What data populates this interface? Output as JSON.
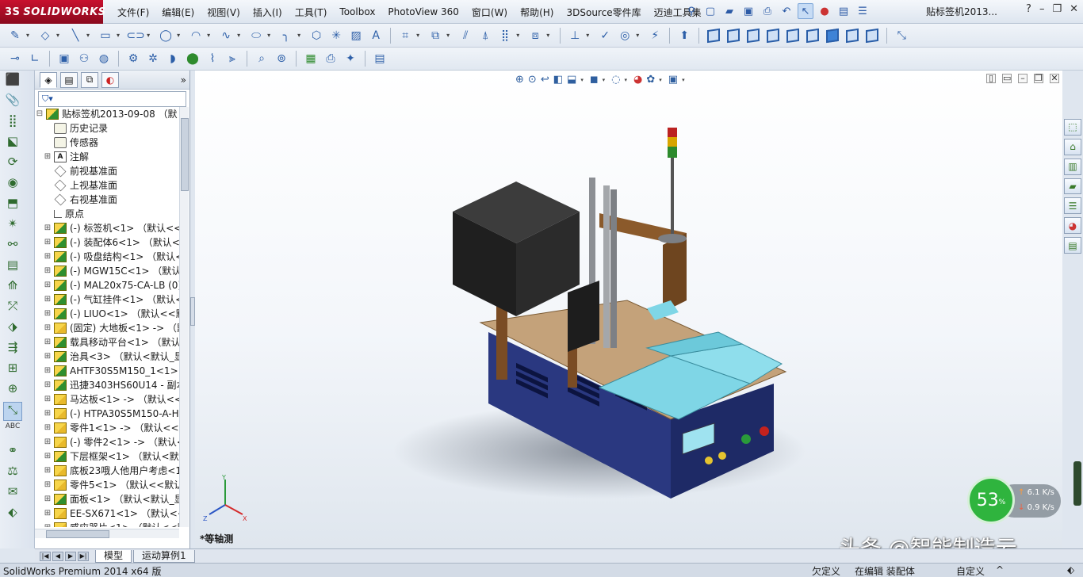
{
  "app": {
    "brand": "SOLIDWORKS",
    "brand_mark": "3S",
    "document_title": "贴标签机2013...",
    "menus": [
      "文件(F)",
      "编辑(E)",
      "视图(V)",
      "插入(I)",
      "工具(T)",
      "Toolbox",
      "PhotoView 360",
      "窗口(W)",
      "帮助(H)",
      "3DSource零件库",
      "迈迪工具集"
    ],
    "help_icon": "?"
  },
  "feature_tree": {
    "filter_icon": "filter-icon",
    "root": "贴标签机2013-09-08 （默",
    "items": [
      {
        "label": "历史记录",
        "icon": "history"
      },
      {
        "label": "传感器",
        "icon": "sensor"
      },
      {
        "label": "注解",
        "icon": "annotation",
        "expandable": true
      },
      {
        "label": "前视基准面",
        "icon": "plane"
      },
      {
        "label": "上视基准面",
        "icon": "plane"
      },
      {
        "label": "右视基准面",
        "icon": "plane"
      },
      {
        "label": "原点",
        "icon": "origin"
      },
      {
        "label": "(-) 标签机<1> （默认<<默",
        "icon": "asm"
      },
      {
        "label": "(-) 装配体6<1> （默认<<默",
        "icon": "asm"
      },
      {
        "label": "(-) 吸盘结构<1> （默认<<默",
        "icon": "asm"
      },
      {
        "label": "(-) MGW15C<1> （默认<<",
        "icon": "asm"
      },
      {
        "label": "(-) MAL20x75-CA-LB (0)",
        "icon": "asm"
      },
      {
        "label": "(-) 气缸挂件<1> （默认<<",
        "icon": "asm"
      },
      {
        "label": "(-) LIUO<1> （默认<<默认",
        "icon": "asm"
      },
      {
        "label": "(固定) 大地板<1> -> （默",
        "icon": "part"
      },
      {
        "label": "载具移动平台<1> （默认<<",
        "icon": "asm"
      },
      {
        "label": "治具<3> （默认<默认_显示",
        "icon": "asm"
      },
      {
        "label": "AHTF30S5M150_1<1> (",
        "icon": "asm"
      },
      {
        "label": "迅捷3403HS60U14 - 副本",
        "icon": "asm"
      },
      {
        "label": "马达板<1> -> （默认<<默",
        "icon": "part"
      },
      {
        "label": "(-) HTPA30S5M150-A-H",
        "icon": "part"
      },
      {
        "label": "零件1<1> -> （默认<<默",
        "icon": "part"
      },
      {
        "label": "(-) 零件2<1> -> （默认<<",
        "icon": "part"
      },
      {
        "label": "下层框架<1> （默认<默认",
        "icon": "asm"
      },
      {
        "label": "底板23哦人他用户考虑<1",
        "icon": "part"
      },
      {
        "label": "零件5<1> （默认<<默认>",
        "icon": "part"
      },
      {
        "label": "面板<1> （默认<默认_显示",
        "icon": "asm"
      },
      {
        "label": "EE-SX671<1> （默认<<默",
        "icon": "part"
      },
      {
        "label": "感应器片<1> （默认<<默",
        "icon": "part"
      }
    ]
  },
  "bottom_tabs": [
    "模型",
    "运动算例1"
  ],
  "viewport": {
    "view_label": "*等轴测",
    "axes": {
      "x": "X",
      "y": "Y",
      "z": "Z"
    }
  },
  "status": {
    "product": "SolidWorks Premium 2014 x64 版",
    "under_defined": "欠定义",
    "editing": "在编辑 装配体",
    "custom": "自定义"
  },
  "network": {
    "percent": "53",
    "percent_unit": "%",
    "upload": "6.1",
    "upload_unit": "K/s",
    "download": "0.9",
    "download_unit": "K/s"
  },
  "watermark": "头条 @智能制造云",
  "colors": {
    "brand": "#c8102e",
    "tray": "#7fd6e6",
    "cabinet": "#2c3d8a",
    "frame": "#8b5a2b",
    "network_ok": "#2fb43e"
  }
}
